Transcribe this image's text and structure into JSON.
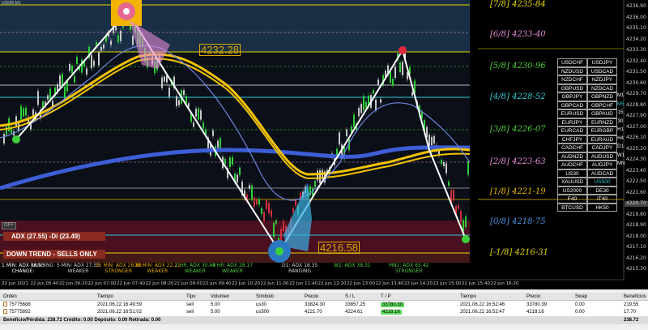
{
  "window": {
    "title": "US500,M1"
  },
  "murray_levels": [
    {
      "label": "[7/8]",
      "price": "4235-84",
      "color": "#e6d800"
    },
    {
      "label": "[6/8]",
      "price": "4233-40",
      "color": "#e58ad5"
    },
    {
      "label": "[5/8]",
      "price": "4230-96",
      "color": "#4ecb3c"
    },
    {
      "label": "[4/8]",
      "price": "4228-52",
      "color": "#31c7d4"
    },
    {
      "label": "[3/8]",
      "price": "4226-07",
      "color": "#4ecb3c"
    },
    {
      "label": "[2/8]",
      "price": "4223-63",
      "color": "#e58ad5"
    },
    {
      "label": "[1/8]",
      "price": "4221-19",
      "color": "#e6b400"
    },
    {
      "label": "[0/8]",
      "price": "4218-75",
      "color": "#4f8fe0"
    },
    {
      "label": "[-1/8]",
      "price": "4216-31",
      "color": "#e6d800"
    }
  ],
  "price_labels": {
    "top_box": "4232.28",
    "bottom_box": "4216.58"
  },
  "price_axis": [
    "4236.90",
    "4236.00",
    "4235.10",
    "4234.20",
    "4233.30",
    "4232.40",
    "4231.50",
    "4230.60",
    "4229.70",
    "4228.80",
    "4227.90",
    "4227.00",
    "4226.10",
    "4225.20",
    "4224.30",
    "4223.40",
    "4222.50",
    "4221.60",
    "4220.70",
    "4219.80",
    "4218.90",
    "4218.00",
    "4217.10",
    "4216.20",
    "4215.30"
  ],
  "time_axis": [
    "22 Jun 2021",
    "22 Jun 05:40",
    "22 Jun 06:20",
    "22 Jun 07:00",
    "22 Jun 07:40",
    "22 Jun 08:20",
    "22 Jun 09:00",
    "22 Jun 09:40",
    "22 Jun 10:20",
    "22 Jun 11:00",
    "22 Jun 11:40",
    "22 Jun 12:20",
    "22 Jun 13:00",
    "22 Jun 13:40",
    "22 Jun 14:20",
    "22 Jun 15:00",
    "22 Jun 15:40",
    "22 Jun 16:20"
  ],
  "symbols": [
    [
      "USDCHF",
      "USDJPY",
      ""
    ],
    [
      "NZDUSD",
      "USDCAD",
      ""
    ],
    [
      "NZDCHF",
      "NZDJPY",
      ""
    ],
    [
      "GBPUSD",
      "NZDCAD",
      ""
    ],
    [
      "GBPJPY",
      "GBPNZD",
      "M1"
    ],
    [
      "GBPCAD",
      "GBPCHF",
      "M5"
    ],
    [
      "EURUSD",
      "GBPAUD",
      "15"
    ],
    [
      "EURJPY",
      "EURNZD",
      "30"
    ],
    [
      "EURCAD",
      "EURGBP",
      "H1"
    ],
    [
      "CHFJPY",
      "EURAUD",
      "H4"
    ],
    [
      "CADCHF",
      "CADJPY",
      "D1"
    ],
    [
      "AUDNZD",
      "AUDUSD",
      "W1"
    ],
    [
      "AUDCHF",
      "AUDJPY",
      "MN"
    ],
    [
      "US30",
      "AUDCAD",
      ""
    ],
    [
      "XAUUSD",
      "US500",
      ""
    ],
    [
      "US2000",
      "DE30",
      ""
    ],
    [
      "F40",
      "IT40",
      ""
    ],
    [
      "BTCUSD",
      "HK50",
      ""
    ]
  ],
  "controls": {
    "off": "OFF",
    "adx": "ADX (27.55)  -Di (23.49)",
    "trend": "DOWN TREND - SELLS ONLY"
  },
  "adx_panels": [
    {
      "title": "1 MIN: ADX 16.53",
      "state": "CHANGE:",
      "color": "#ffffff"
    },
    {
      "title": "",
      "state": "RANGING",
      "color": "#cfcfcf"
    },
    {
      "title": "5 MIN: ADX 27.55",
      "state": "WEAKER",
      "color": "#cfcfcf"
    },
    {
      "title": "15 MIN: ADX 28.86",
      "state": "STRONGER",
      "color": "#e6a800"
    },
    {
      "title": "30 MIN: ADX 22.21",
      "state": "WEAKER",
      "color": "#e6a800"
    },
    {
      "title": "1 HR: ADX 30.40",
      "state": "WEAKER",
      "color": "#4ecb3c"
    },
    {
      "title": "4 HR: ADX 28.17",
      "state": "WEAKER",
      "color": "#4ecb3c"
    },
    {
      "title": "D1: ADX 18.35",
      "state": "RANGING",
      "color": "#cfcfcf"
    },
    {
      "title": "W1: ADX 38.31",
      "state": "",
      "color": "#4ecb3c"
    },
    {
      "title": "MN1: ADX 65.42",
      "state": "STRONGER",
      "color": "#4ecb3c"
    }
  ],
  "terminal": {
    "headers": [
      "Orden",
      "Tiempo",
      "Tipo",
      "Volumen",
      "Símbolo",
      "Precio",
      "S / L",
      "T / P",
      "Tiempo",
      "Precio",
      "Swap",
      "Beneficios"
    ],
    "rows": [
      [
        "75775688",
        "2021.06.22 16:49:59",
        "sell",
        "5.00",
        "us30",
        "33824.30",
        "33857.25",
        "33780.30",
        "2021.06.22 16:52:46",
        "33780.39",
        "0.00",
        "219.55"
      ],
      [
        "75775892",
        "2021.06.22 16:51:02",
        "sell",
        "5.00",
        "us500",
        "4221.70",
        "4224.61",
        "4218.16",
        "2021.06.22 16:52:47",
        "4218.16",
        "0.00",
        "17.70"
      ]
    ],
    "summary": "Beneficio/Pérdida: 238.72  Crédito: 0.00  Depósito: 0.00  Retirada: 0.00",
    "total": "238.72"
  }
}
